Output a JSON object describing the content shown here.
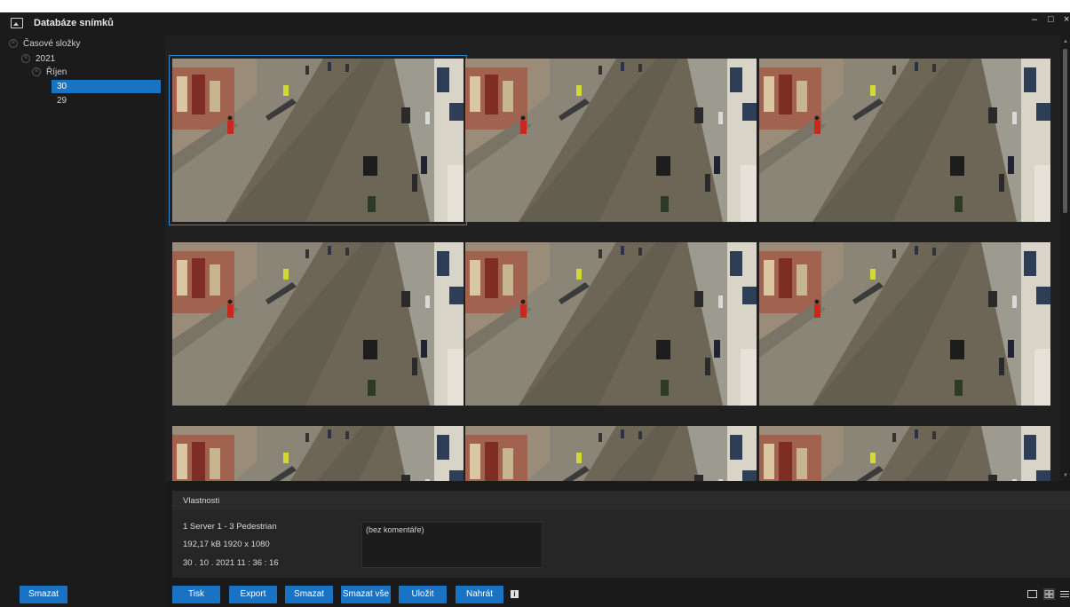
{
  "window": {
    "title": "Databáze snímků",
    "minimize": "–",
    "maximize": "□",
    "close": "×"
  },
  "tree": {
    "root": "Časové složky",
    "year": "2021",
    "month": "Říjen",
    "days": [
      "30",
      "29"
    ],
    "selected_day": "30"
  },
  "sidebar": {
    "delete_label": "Smazat"
  },
  "properties": {
    "header": "Vlastnosti",
    "source": "1 Server 1 - 3 Pedestrian",
    "file_info": "192,17 kB   1920 x 1080",
    "timestamp": "30 . 10 . 2021 11 : 36 : 16",
    "comment": "(bez komentáře)"
  },
  "toolbar": {
    "print": "Tisk",
    "export": "Export",
    "delete": "Smazat",
    "delete_all": "Smazat vše",
    "save": "Uložit",
    "upload": "Nahrát",
    "info_glyph": "i"
  },
  "colors": {
    "accent": "#1a73c2",
    "background": "#1a1a1a",
    "selection_outline": "#2a8ad8"
  },
  "icons": [
    "image-icon",
    "info-icon",
    "single-view-icon",
    "grid-view-icon",
    "list-view-icon"
  ]
}
